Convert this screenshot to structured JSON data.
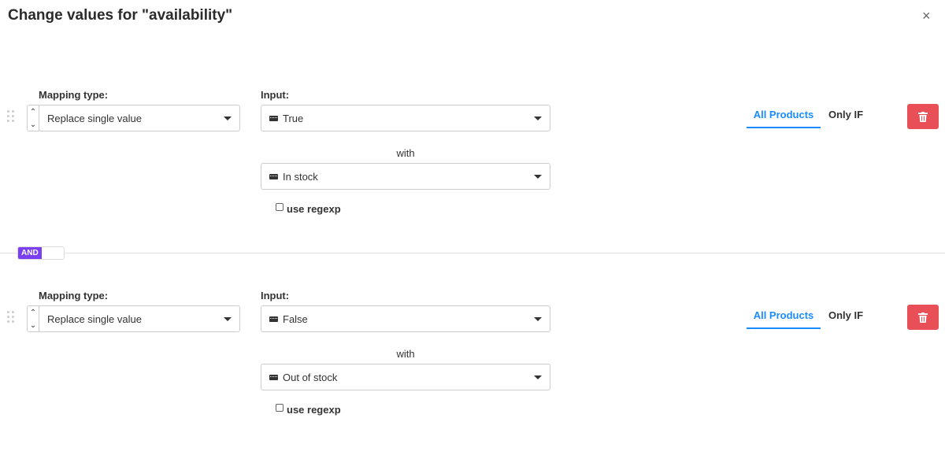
{
  "title": "Change values for \"availability\"",
  "close_label": "×",
  "join_operator": "AND",
  "rules": [
    {
      "mapping_label": "Mapping type:",
      "mapping_value": "Replace single value",
      "input_label": "Input:",
      "input_value": "True",
      "with_label": "with",
      "with_value": "In stock",
      "regexp_label": "use regexp",
      "regexp_checked": false,
      "tabs": [
        "All Products",
        "Only IF"
      ],
      "active_tab": "All Products"
    },
    {
      "mapping_label": "Mapping type:",
      "mapping_value": "Replace single value",
      "input_label": "Input:",
      "input_value": "False",
      "with_label": "with",
      "with_value": "Out of stock",
      "regexp_label": "use regexp",
      "regexp_checked": false,
      "tabs": [
        "All Products",
        "Only IF"
      ],
      "active_tab": "All Products"
    }
  ],
  "colors": {
    "accent": "#1a8cff",
    "danger": "#e94f57",
    "and_badge": "#7b3ff2"
  }
}
